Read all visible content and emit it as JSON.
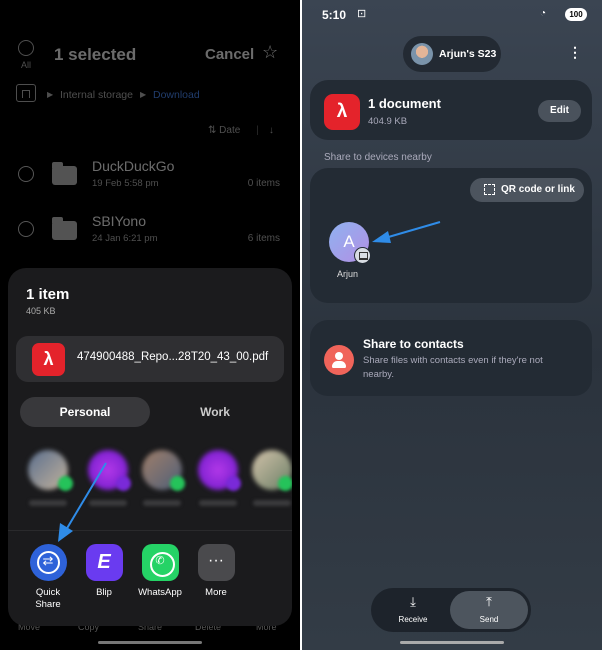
{
  "left": {
    "header": {
      "select_all_label": "All",
      "title": "1 selected",
      "cancel_label": "Cancel"
    },
    "breadcrumb": {
      "items": [
        "Internal storage",
        "Download"
      ]
    },
    "sort": {
      "label": "Date"
    },
    "rows": [
      {
        "name": "DuckDuckGo",
        "date": "19 Feb 5:58 pm",
        "count": "0 items"
      },
      {
        "name": "SBIYono",
        "date": "24 Jan 6:21 pm",
        "count": "6 items"
      }
    ],
    "sheet": {
      "title": "1 item",
      "size": "405 KB",
      "file_name": "474900488_Repo...28T20_43_00.pdf",
      "tabs": [
        "Personal",
        "Work"
      ],
      "apps": [
        {
          "label": "Quick Share",
          "icon": "quick-share-icon"
        },
        {
          "label": "Blip",
          "icon": "blip-icon"
        },
        {
          "label": "WhatsApp",
          "icon": "whatsapp-icon"
        },
        {
          "label": "More",
          "icon": "more-icon"
        }
      ]
    },
    "bottom_actions": [
      "Move",
      "Copy",
      "Share",
      "Delete",
      "More"
    ]
  },
  "right": {
    "status": {
      "time": "5:10",
      "battery": "100"
    },
    "device": {
      "name": "Arjun's S23"
    },
    "document": {
      "title": "1 document",
      "size": "404.9 KB",
      "edit_label": "Edit"
    },
    "nearby": {
      "header": "Share to devices nearby",
      "qr_label": "QR code or link",
      "device_initial": "A",
      "device_label": "Arjun"
    },
    "contacts": {
      "title": "Share to contacts",
      "subtitle": "Share files with contacts even if they're not nearby."
    },
    "segment": {
      "receive_label": "Receive",
      "send_label": "Send"
    }
  },
  "colors": {
    "accent_blue": "#2e62d9",
    "pdf_red": "#e4232b",
    "whatsapp_green": "#25d366",
    "blip_purple": "#6a3bf0",
    "annotation_arrow": "#2f8ce8"
  }
}
